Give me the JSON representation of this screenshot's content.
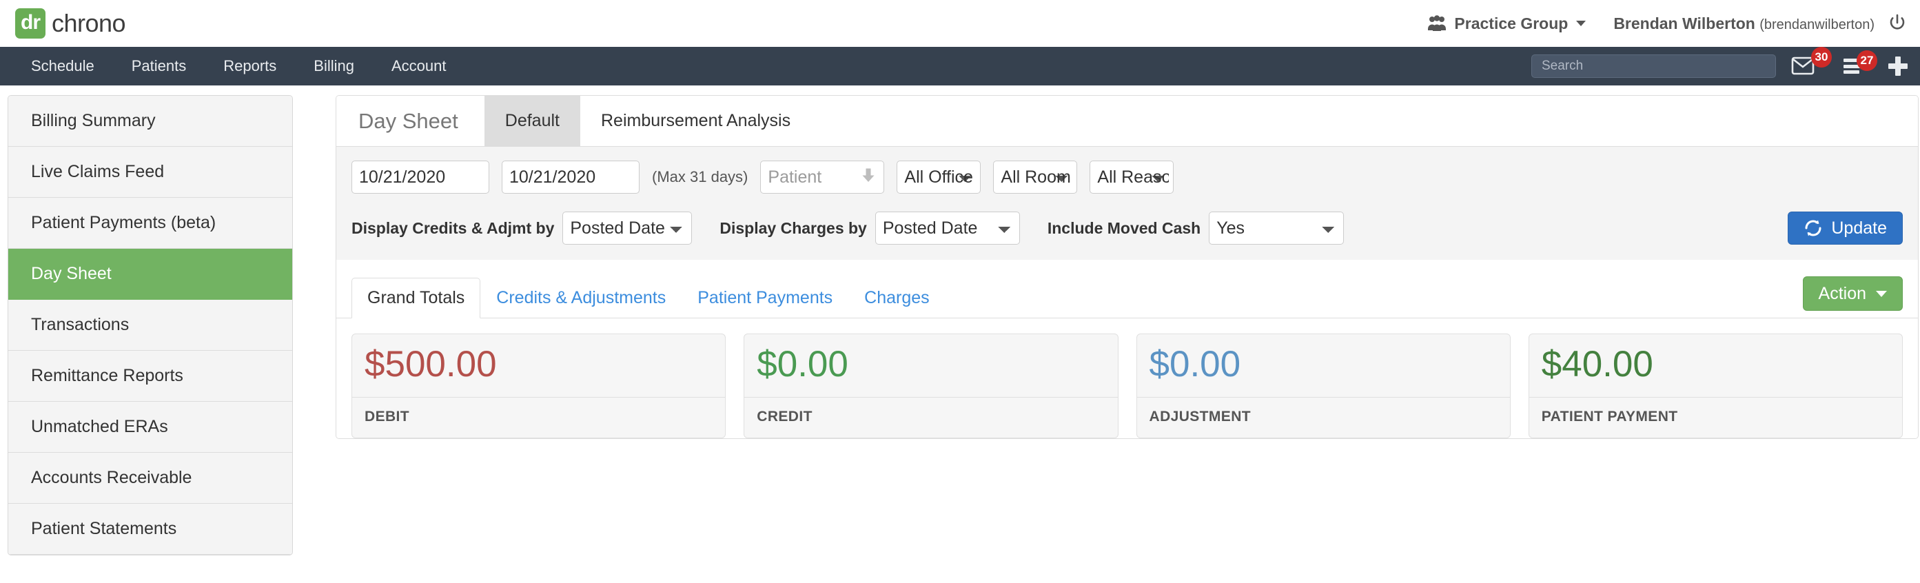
{
  "header": {
    "logo_badge": "dr",
    "logo_word": "chrono",
    "practice_group": "Practice Group",
    "user_name": "Brendan Wilberton",
    "user_handle": "(brendanwilberton)",
    "people_icon": "people-icon",
    "power_icon": "power-icon"
  },
  "nav": {
    "items": [
      {
        "label": "Schedule"
      },
      {
        "label": "Patients"
      },
      {
        "label": "Reports"
      },
      {
        "label": "Billing"
      },
      {
        "label": "Account"
      }
    ],
    "search_placeholder": "Search",
    "search_value": "",
    "mail_badge": "30",
    "menu_badge": "27"
  },
  "sidebar": {
    "items": [
      {
        "label": "Billing Summary",
        "active": false
      },
      {
        "label": "Live Claims Feed",
        "active": false
      },
      {
        "label": "Patient Payments (beta)",
        "active": false
      },
      {
        "label": "Day Sheet",
        "active": true
      },
      {
        "label": "Transactions",
        "active": false
      },
      {
        "label": "Remittance Reports",
        "active": false
      },
      {
        "label": "Unmatched ERAs",
        "active": false
      },
      {
        "label": "Accounts Receivable",
        "active": false
      },
      {
        "label": "Patient Statements",
        "active": false
      }
    ]
  },
  "panel": {
    "tabs": [
      {
        "label": "Day Sheet",
        "kind": "title"
      },
      {
        "label": "Default",
        "kind": "selected"
      },
      {
        "label": "Reimbursement Analysis",
        "kind": "plain"
      }
    ],
    "filters": {
      "date_from": "10/21/2020",
      "date_to": "10/21/2020",
      "max_days_note": "(Max 31 days)",
      "patient_placeholder": "Patient",
      "patient_value": "",
      "office_value": "All Office",
      "room_value": "All Room",
      "reason_value": "All Reason",
      "credits_label": "Display Credits & Adjmt by",
      "credits_value": "Posted Date",
      "charges_label": "Display Charges by",
      "charges_value": "Posted Date",
      "moved_cash_label": "Include Moved Cash",
      "moved_cash_value": "Yes",
      "update_label": "Update"
    },
    "inner_tabs": [
      {
        "label": "Grand Totals",
        "active": true
      },
      {
        "label": "Credits & Adjustments",
        "active": false
      },
      {
        "label": "Patient Payments",
        "active": false
      },
      {
        "label": "Charges",
        "active": false
      }
    ],
    "action_label": "Action",
    "cards": [
      {
        "value": "$500.00",
        "label": "DEBIT",
        "color": "#b4504b"
      },
      {
        "value": "$0.00",
        "label": "CREDIT",
        "color": "#4a9a52"
      },
      {
        "value": "$0.00",
        "label": "ADJUSTMENT",
        "color": "#5b93c4"
      },
      {
        "value": "$40.00",
        "label": "PATIENT PAYMENT",
        "color": "#44813f"
      }
    ]
  },
  "colors": {
    "nav_bg": "#36414f",
    "accent_green": "#72b362",
    "accent_blue": "#2f72c4",
    "badge_red": "#cf2a27"
  }
}
